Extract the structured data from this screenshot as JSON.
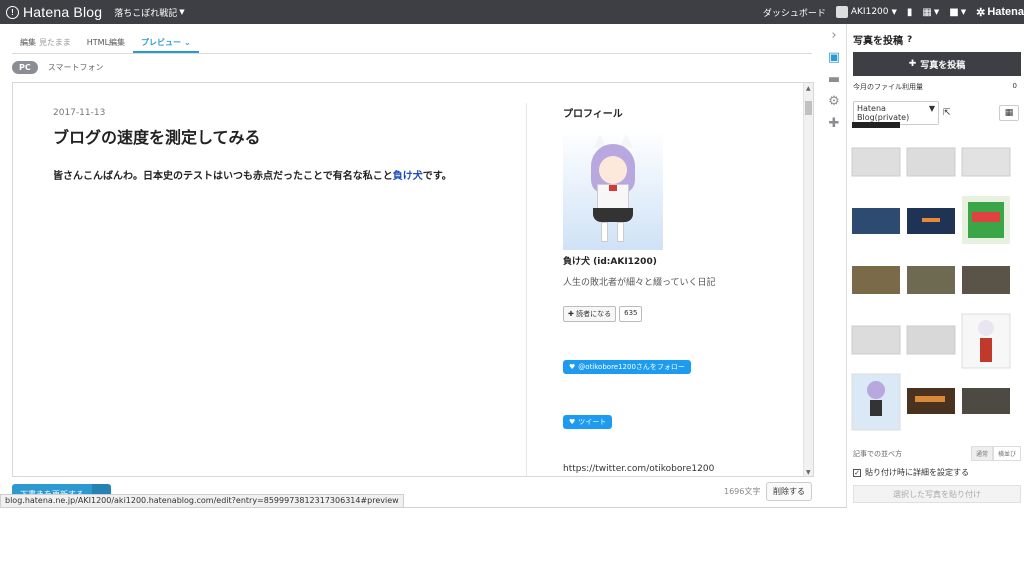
{
  "topbar": {
    "logo_text": "Hatena Blog",
    "blog_name": "落ちこぼれ戦記",
    "dashboard": "ダッシュボード",
    "user_name": "AKI1200",
    "hatena_label": "Hatena"
  },
  "editor": {
    "tabs": [
      {
        "label": "編集",
        "sub": "見たまま"
      },
      {
        "label": "HTML編集"
      },
      {
        "label": "プレビュー"
      }
    ],
    "device_pc": "PC",
    "device_smartphone": "スマートフォン"
  },
  "preview": {
    "date": "2017-11-13",
    "title": "ブログの速度を測定してみる",
    "body_text": "皆さんこんばんわ。日本史のテストはいつも赤点だったことで有名な私こと",
    "body_link": "負け犬",
    "body_end": "です。",
    "sidebar": {
      "heading": "プロフィール",
      "name": "負け犬 (id:AKI1200)",
      "description": "人生の敗北者が細々と綴っていく日記",
      "reader_button": "読者になる",
      "reader_count": "635",
      "twitter_follow": "@otikobore1200さんをフォロー",
      "tweet": "ツイート",
      "twitter_url": "https://twitter.com/otikobore1200"
    }
  },
  "footer": {
    "draft_button": "下書きを更新する",
    "char_count": "1696文字",
    "delete_button": "削除する",
    "status_url": "blog.hatena.ne.jp/AKI1200/aki1200.hatenablog.com/edit?entry=8599973812317306314#preview"
  },
  "panel": {
    "title": "写真を投稿",
    "post_button": "写真を投稿",
    "usage_label": "今月のファイル利用量",
    "usage_value": "0",
    "folder": "Hatena Blog(private)",
    "sort_label": "記事での並べ方",
    "sort_options": [
      "通常",
      "横並び"
    ],
    "detail_checkbox": "貼り付け時に詳細を設定する",
    "paste_button": "選択した写真を貼り付け"
  },
  "icons": {
    "strip": [
      "chevron-right-icon",
      "photo-icon",
      "folder-icon",
      "gear-icon",
      "plus-icon"
    ]
  },
  "colors": {
    "topbar": "#3d3f44",
    "accent": "#2c9ad1",
    "twitter": "#1d9bf0",
    "link": "#1a4bb8"
  }
}
